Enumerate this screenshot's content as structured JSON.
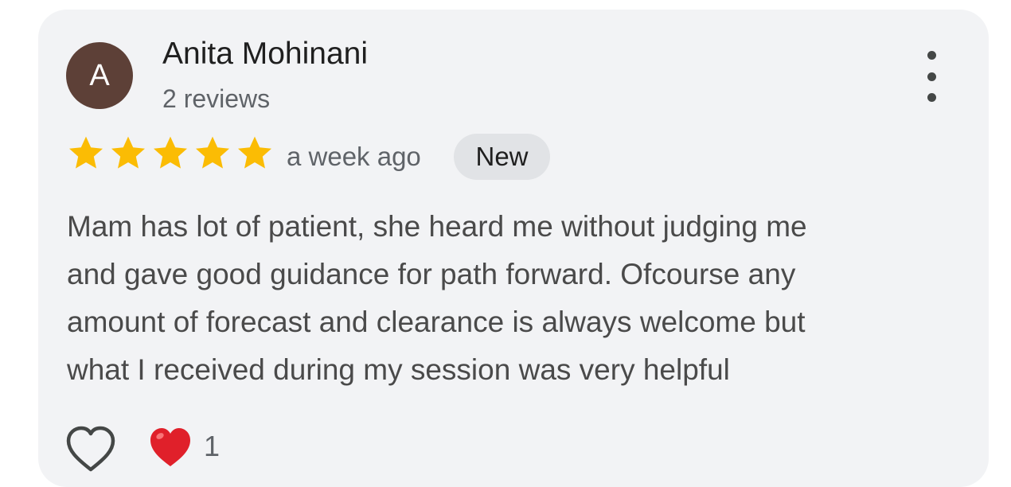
{
  "review": {
    "author": {
      "initial": "A",
      "name": "Anita Mohinani",
      "reviews_count": "2 reviews",
      "avatar_color": "#5d4037"
    },
    "rating": 5,
    "max_rating": 5,
    "time": "a week ago",
    "badge": "New",
    "text_lines": [
      "Mam has lot of patient, she heard me without judging me",
      "and gave good guidance for path forward. Ofcourse any",
      "amount of forecast and clearance is always welcome but",
      "what I received during my session was very helpful"
    ],
    "reactions": {
      "like_icon": "heart-outline-icon",
      "reaction_icon": "red-heart-icon",
      "count": "1"
    },
    "menu_icon": "more-vert-icon",
    "star_color": "#fbbc04"
  }
}
